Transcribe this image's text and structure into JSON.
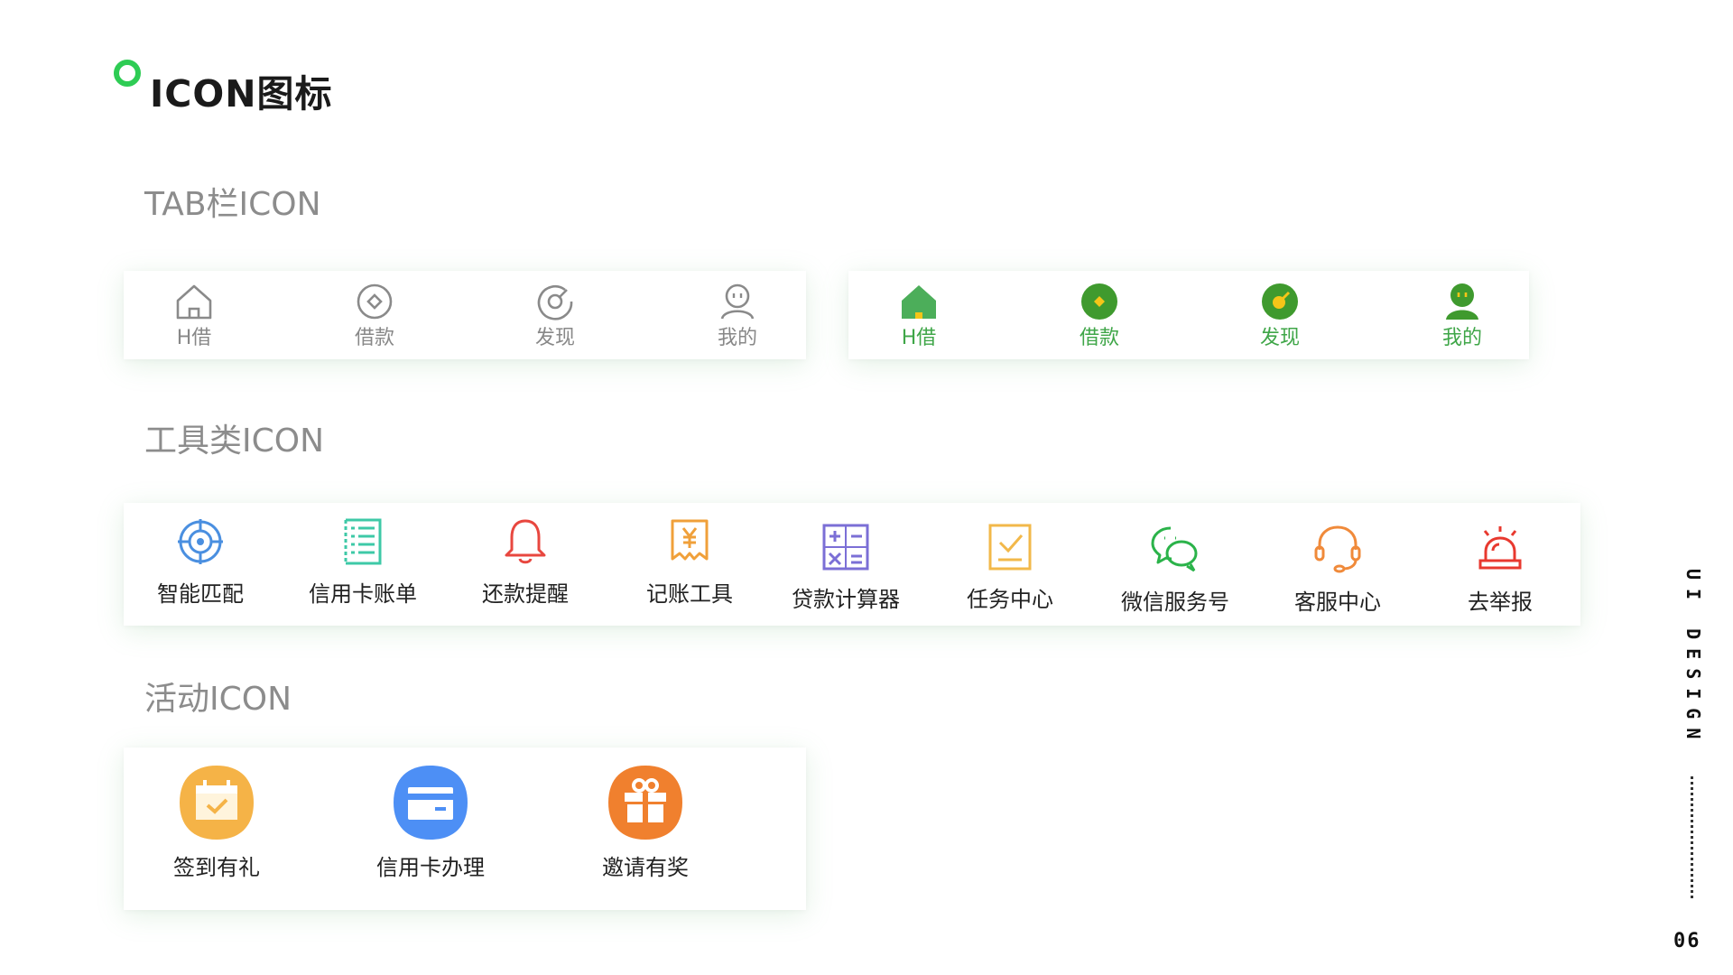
{
  "header": {
    "title": "ICON图标",
    "accent_color": "#2ecc54"
  },
  "sections": {
    "tab": "TAB栏ICON",
    "tool": "工具类ICON",
    "activity": "活动ICON"
  },
  "tab_bar_inactive": {
    "color": "#8a8a8a",
    "items": [
      {
        "label": "H借",
        "icon": "home-icon"
      },
      {
        "label": "借款",
        "icon": "loan-coin-icon"
      },
      {
        "label": "发现",
        "icon": "discover-compass-icon"
      },
      {
        "label": "我的",
        "icon": "user-icon"
      }
    ]
  },
  "tab_bar_active": {
    "color": "#3fa648",
    "items": [
      {
        "label": "H借",
        "icon": "home-filled-icon"
      },
      {
        "label": "借款",
        "icon": "loan-coin-filled-icon"
      },
      {
        "label": "发现",
        "icon": "discover-compass-filled-icon"
      },
      {
        "label": "我的",
        "icon": "user-filled-icon"
      }
    ]
  },
  "tools": [
    {
      "label": "智能匹配",
      "icon": "target-icon",
      "color": "#4a8fe0"
    },
    {
      "label": "信用卡账单",
      "icon": "bill-list-icon",
      "color": "#3ec9a7"
    },
    {
      "label": "还款提醒",
      "icon": "bell-icon",
      "color": "#e8473f"
    },
    {
      "label": "记账工具",
      "icon": "yen-receipt-icon",
      "color": "#f0a03a"
    },
    {
      "label": "贷款计算器",
      "icon": "calculator-icon",
      "color": "#7b6fd6"
    },
    {
      "label": "任务中心",
      "icon": "task-check-icon",
      "color": "#f2b84a"
    },
    {
      "label": "微信服务号",
      "icon": "wechat-icon",
      "color": "#2bb34a"
    },
    {
      "label": "客服中心",
      "icon": "headset-icon",
      "color": "#f08a3a"
    },
    {
      "label": "去举报",
      "icon": "alarm-siren-icon",
      "color": "#e8392f"
    }
  ],
  "activities": [
    {
      "label": "签到有礼",
      "icon": "calendar-check-icon",
      "color": "#f5b347"
    },
    {
      "label": "信用卡办理",
      "icon": "credit-card-icon",
      "color": "#4d8ff5"
    },
    {
      "label": "邀请有奖",
      "icon": "gift-icon",
      "color": "#f0802e"
    }
  ],
  "side": {
    "label": "UI DESIGN",
    "page": "06"
  }
}
